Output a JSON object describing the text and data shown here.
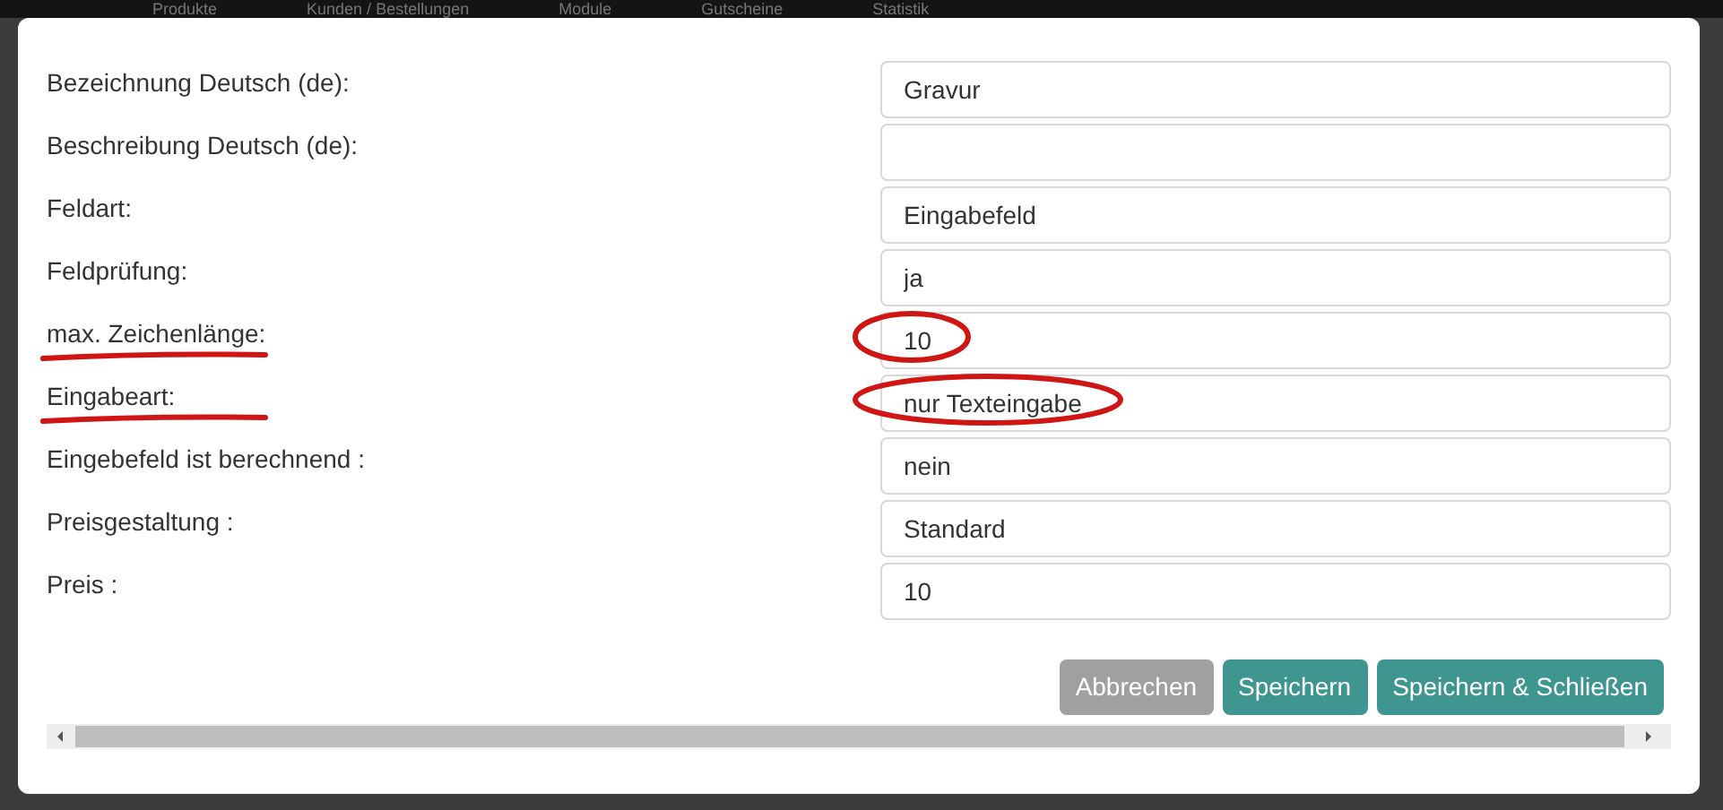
{
  "background_nav": [
    {
      "label": "Produkte"
    },
    {
      "label": "Kunden / Bestellungen"
    },
    {
      "label": "Module"
    },
    {
      "label": "Gutscheine"
    },
    {
      "label": "Statistik"
    }
  ],
  "form": {
    "rows": [
      {
        "label": "Bezeichnung Deutsch (de):",
        "value": "Gravur",
        "label_underlined": false,
        "value_circled": false
      },
      {
        "label": "Beschreibung Deutsch (de):",
        "value": "",
        "label_underlined": false,
        "value_circled": false
      },
      {
        "label": "Feldart:",
        "value": "Eingabefeld",
        "label_underlined": false,
        "value_circled": false
      },
      {
        "label": "Feldprüfung:",
        "value": "ja",
        "label_underlined": false,
        "value_circled": false
      },
      {
        "label": "max. Zeichenlänge:",
        "value": "10",
        "label_underlined": true,
        "value_circled": true
      },
      {
        "label": "Eingabeart:",
        "value": "nur Texteingabe",
        "label_underlined": true,
        "value_circled": true
      },
      {
        "label": "Eingebefeld ist berechnend :",
        "value": "nein",
        "label_underlined": false,
        "value_circled": false
      },
      {
        "label": "Preisgestaltung :",
        "value": "Standard",
        "label_underlined": false,
        "value_circled": false
      },
      {
        "label": "Preis :",
        "value": "10",
        "label_underlined": false,
        "value_circled": false
      }
    ]
  },
  "buttons": [
    {
      "label": "Abbrechen",
      "kind": "cancel"
    },
    {
      "label": "Speichern",
      "kind": "primary"
    },
    {
      "label": "Speichern & Schließen",
      "kind": "primary"
    }
  ]
}
